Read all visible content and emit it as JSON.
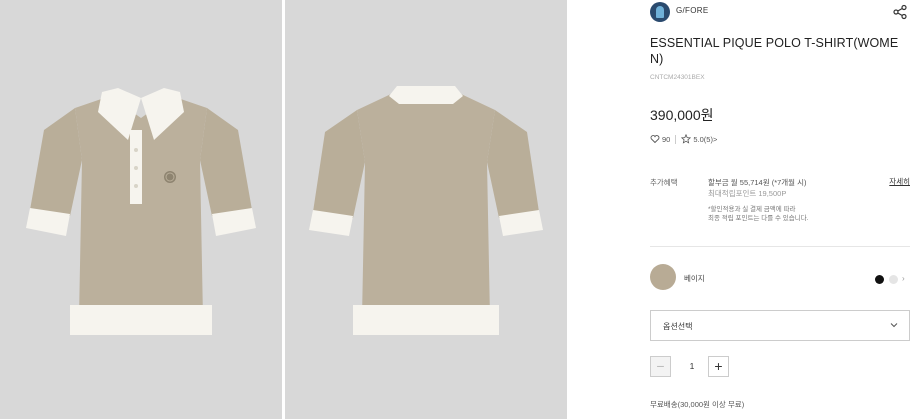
{
  "product_images": {
    "front_alt": "front view",
    "back_alt": "back view"
  },
  "brand": {
    "name": "G/FORE"
  },
  "product": {
    "title": "ESSENTIAL PIQUE POLO T-SHIRT(WOME N)",
    "code": "CNTCM24301BEX",
    "price": "390,000원"
  },
  "rating": {
    "likes": "90",
    "score": "5.0(5)",
    "arrow": ">"
  },
  "benefits": {
    "label": "추가혜택",
    "installment": "할부금 월 55,714원 (*7개월 시)",
    "points": "최대적립포인트 19,500P",
    "note_line1": "*할인적용과 실 결제 금액에 따라",
    "note_line2": "최종 적립 포인트는 다를 수 있습니다.",
    "detail_link": "자세히"
  },
  "color_option": {
    "name": "베이지",
    "swatch_color": "#b8ab95",
    "chevron": "›"
  },
  "option_select": {
    "label": "옵션선택"
  },
  "quantity": {
    "minus": "−",
    "value": "1",
    "plus": "+"
  },
  "shipping": {
    "text": "무료배송(30,000원 이상 무료)"
  }
}
